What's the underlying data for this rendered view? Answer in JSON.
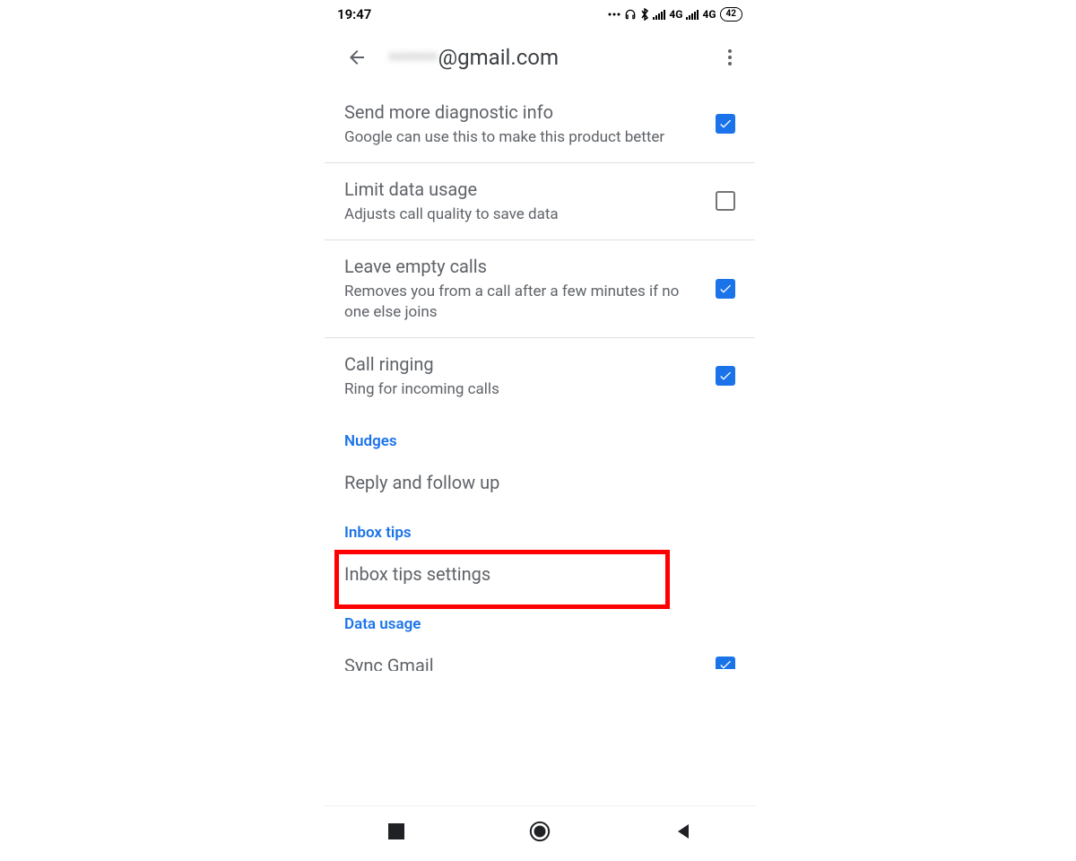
{
  "statusbar": {
    "time": "19:47",
    "network1": "4G",
    "network2": "4G",
    "battery": "42"
  },
  "appbar": {
    "email_hidden": "••••••",
    "email_visible": "@gmail.com"
  },
  "settings": {
    "diagnostic": {
      "title": "Send more diagnostic info",
      "desc": "Google can use this to make this product better",
      "checked": true
    },
    "limit_data": {
      "title": "Limit data usage",
      "desc": "Adjusts call quality to save data",
      "checked": false
    },
    "leave_empty": {
      "title": "Leave empty calls",
      "desc": "Removes you from a call after a few minutes if no one else joins",
      "checked": true
    },
    "call_ringing": {
      "title": "Call ringing",
      "desc": "Ring for incoming calls",
      "checked": true
    }
  },
  "sections": {
    "nudges": "Nudges",
    "reply_follow": "Reply and follow up",
    "inbox_tips": "Inbox tips",
    "inbox_tips_settings": "Inbox tips settings",
    "data_usage": "Data usage",
    "sync_gmail": "Sync Gmail"
  }
}
